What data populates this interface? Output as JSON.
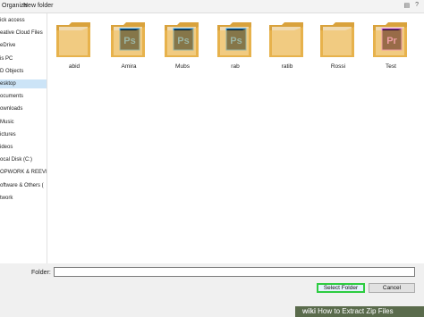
{
  "toolbar": {
    "items": [
      "Organize",
      "New folder"
    ],
    "view_glyph": "▤",
    "help_glyph": "?"
  },
  "sidebar": {
    "items": [
      {
        "label": "ick access",
        "selected": false
      },
      {
        "label": "eative Cloud Files",
        "selected": false
      },
      {
        "label": "eDrive",
        "selected": false
      },
      {
        "label": "is PC",
        "selected": false
      },
      {
        "label": "D Objects",
        "selected": false
      },
      {
        "label": "esktop",
        "selected": true
      },
      {
        "label": "ocuments",
        "selected": false
      },
      {
        "label": "ownloads",
        "selected": false
      },
      {
        "label": "Music",
        "selected": false
      },
      {
        "label": "ictures",
        "selected": false
      },
      {
        "label": "ideos",
        "selected": false
      },
      {
        "label": "ocal Disk (C:)",
        "selected": false
      },
      {
        "label": "OPWORK & REEVIO",
        "selected": false
      },
      {
        "label": "oftware & Others (",
        "selected": false
      },
      {
        "label": "twork",
        "selected": false
      }
    ]
  },
  "items": [
    {
      "name": "abid",
      "badge": ""
    },
    {
      "name": "Amira",
      "badge": "Ps"
    },
    {
      "name": "Mubs",
      "badge": "Ps"
    },
    {
      "name": "rab",
      "badge": "Ps"
    },
    {
      "name": "ratib",
      "badge": ""
    },
    {
      "name": "Rossi",
      "badge": ""
    },
    {
      "name": "Test",
      "badge": "Pr"
    }
  ],
  "footer": {
    "folder_label": "Folder:",
    "folder_value": "",
    "select_label": "Select Folder",
    "cancel_label": "Cancel"
  },
  "watermark": {
    "brand": "wiki",
    "text": "How to Extract Zip Files"
  },
  "colors": {
    "folder": "#f2c05a",
    "folder_dark": "#d9a23c",
    "ps": "#31a8ff",
    "ps_bg": "#001e36",
    "pr": "#ea77ff",
    "pr_bg": "#2a0634",
    "select_border": "#2ecc40"
  }
}
